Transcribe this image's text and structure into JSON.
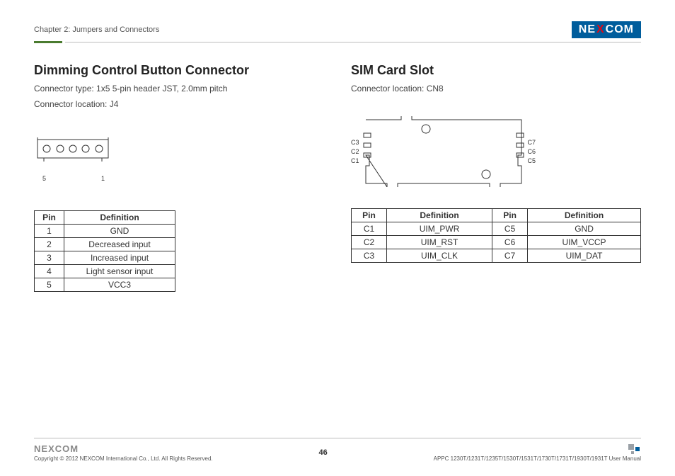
{
  "header": {
    "chapter": "Chapter 2: Jumpers and Connectors",
    "logo_pre": "NE",
    "logo_x": "X",
    "logo_post": "COM"
  },
  "left": {
    "title": "Dimming Control Button Connector",
    "sub1": "Connector type: 1x5 5-pin header JST, 2.0mm pitch",
    "sub2": "Connector location: J4",
    "diagram_labels": {
      "left": "5",
      "right": "1"
    },
    "table": {
      "headers": [
        "Pin",
        "Definition"
      ],
      "rows": [
        [
          "1",
          "GND"
        ],
        [
          "2",
          "Decreased input"
        ],
        [
          "3",
          "Increased input"
        ],
        [
          "4",
          "Light sensor input"
        ],
        [
          "5",
          "VCC3"
        ]
      ]
    }
  },
  "right": {
    "title": "SIM Card Slot",
    "sub1": "Connector location: CN8",
    "diagram_labels": {
      "left": [
        "C3",
        "C2",
        "C1"
      ],
      "right": [
        "C7",
        "C6",
        "C5"
      ]
    },
    "table": {
      "headers": [
        "Pin",
        "Definition",
        "Pin",
        "Definition"
      ],
      "rows": [
        [
          "C1",
          "UIM_PWR",
          "C5",
          "GND"
        ],
        [
          "C2",
          "UIM_RST",
          "C6",
          "UIM_VCCP"
        ],
        [
          "C3",
          "UIM_CLK",
          "C7",
          "UIM_DAT"
        ]
      ]
    }
  },
  "footer": {
    "logo_pre": "NE",
    "logo_x": "X",
    "logo_post": "COM",
    "copyright": "Copyright © 2012 NEXCOM International Co., Ltd. All Rights Reserved.",
    "page": "46",
    "manual": "APPC 1230T/1231T/1235T/1530T/1531T/1730T/1731T/1930T/1931T User Manual"
  }
}
